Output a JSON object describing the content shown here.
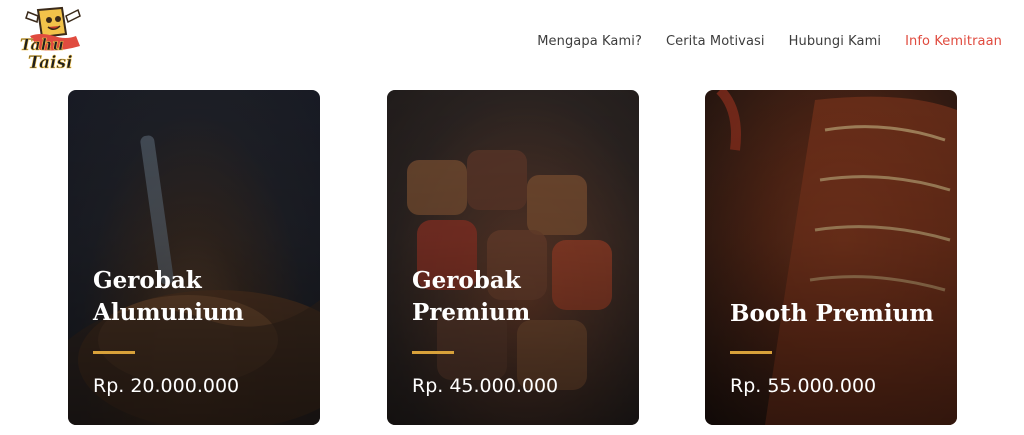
{
  "brand": {
    "logo_text_line1": "Tahu",
    "logo_text_line2": "Taisi"
  },
  "nav": {
    "items": [
      {
        "label": "Mengapa Kami?"
      },
      {
        "label": "Cerita Motivasi"
      },
      {
        "label": "Hubungi Kami"
      },
      {
        "label": "Info Kemitraan"
      }
    ]
  },
  "cards": [
    {
      "title_line1": "Gerobak",
      "title_line2": "Alumunium",
      "price": "Rp. 20.000.000"
    },
    {
      "title_line1": "Gerobak",
      "title_line2": "Premium",
      "price": "Rp. 45.000.000"
    },
    {
      "title_line1": "Booth Premium",
      "title_line2": "",
      "price": "Rp. 55.000.000"
    }
  ],
  "colors": {
    "accent_nav_active": "#e04b3f",
    "card_rule": "#d8a13a",
    "text_nav": "#3d3d3d"
  }
}
